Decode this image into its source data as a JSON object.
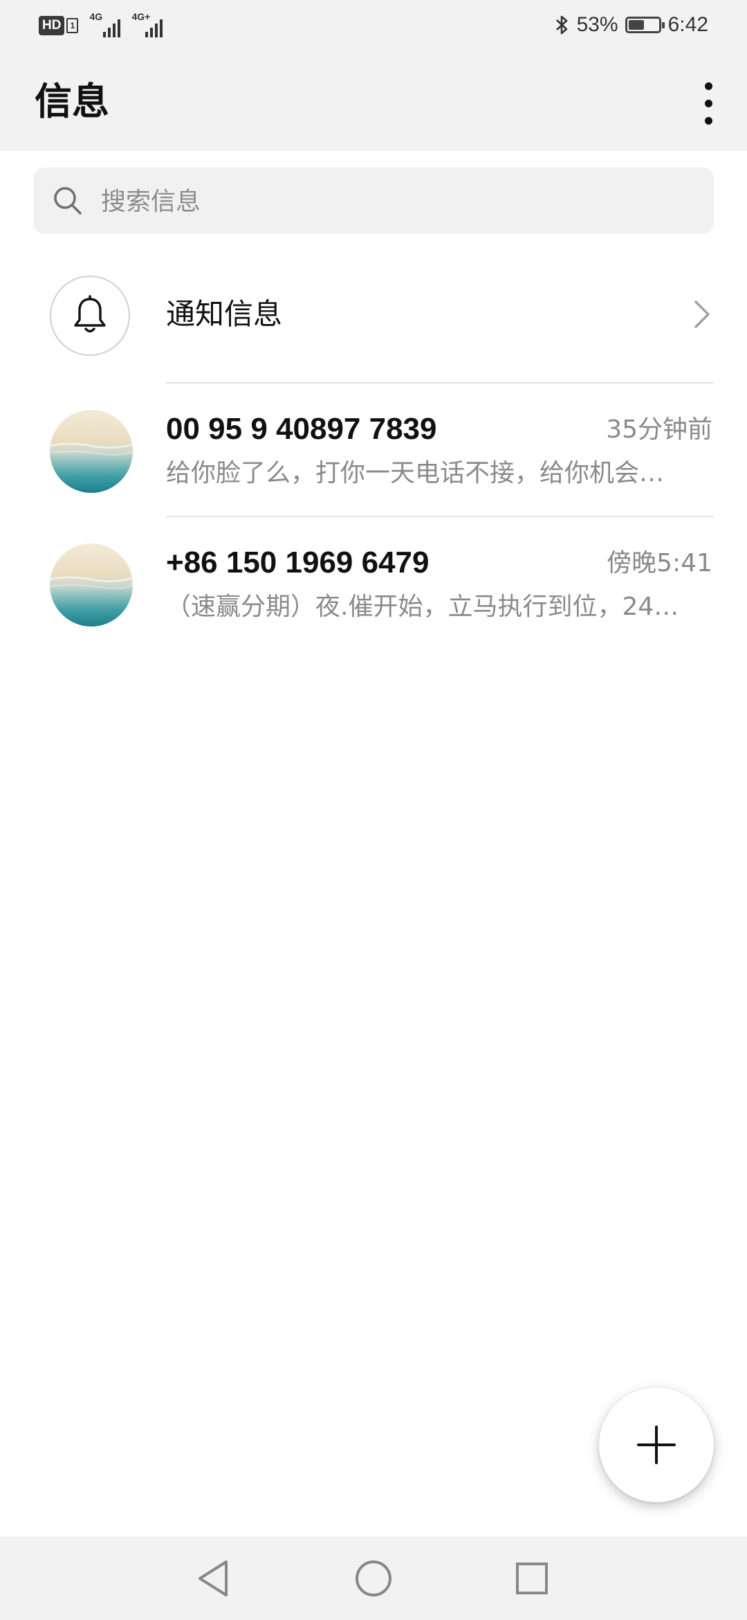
{
  "status_bar": {
    "hd_label": "HD",
    "hd_sub": "1",
    "network_1": "4G",
    "network_2": "4G+",
    "bluetooth_icon": "bluetooth-icon",
    "battery_percent": "53%",
    "battery_level": 0.53,
    "time": "6:42"
  },
  "app_bar": {
    "title": "信息",
    "more_icon": "more-vertical-icon"
  },
  "search": {
    "icon": "search-icon",
    "placeholder": "搜索信息",
    "value": ""
  },
  "notifications": {
    "icon": "bell-icon",
    "label": "通知信息",
    "chevron_icon": "chevron-right-icon"
  },
  "conversations": [
    {
      "name": "00 95 9 40897 7839",
      "time": "35分钟前",
      "preview": "给你脸了么，打你一天电话不接，给你机会…"
    },
    {
      "name": "+86 150 1969 6479",
      "time": "傍晚5:41",
      "preview": "（速赢分期）夜.催开始，立马执行到位，24…"
    }
  ],
  "fab": {
    "icon": "plus-icon"
  },
  "nav_bar": {
    "back_icon": "back-triangle-icon",
    "home_icon": "home-circle-icon",
    "recents_icon": "recents-square-icon"
  },
  "colors": {
    "bar_background": "#f2f2f2",
    "primary_text": "#111111",
    "secondary_text": "#8a8a8a",
    "divider": "#e2e2e2"
  }
}
